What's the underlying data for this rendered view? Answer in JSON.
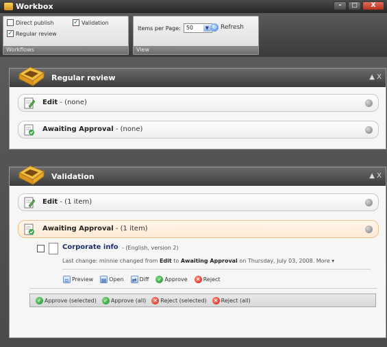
{
  "window": {
    "title": "Workbox",
    "controls": [
      "-",
      "□",
      "X"
    ]
  },
  "ribbon": {
    "workflows": {
      "label": "Workflows",
      "checkboxes": [
        {
          "label": "Direct publish",
          "checked": false
        },
        {
          "label": "Validation",
          "checked": true
        },
        {
          "label": "Regular review",
          "checked": true
        }
      ]
    },
    "view": {
      "label": "View",
      "items_per_page_label": "Items per Page:",
      "items_per_page_value": "50",
      "refresh_label": "Refresh"
    }
  },
  "panels": [
    {
      "title": "Regular review",
      "controls": "▲ X",
      "rows": [
        {
          "state": "Edit",
          "count": "- (none)"
        },
        {
          "state": "Awaiting Approval",
          "count": "- (none)"
        }
      ]
    },
    {
      "title": "Validation",
      "controls": "▲ X",
      "rows": [
        {
          "state": "Edit",
          "count": "- (1 item)"
        },
        {
          "state": "Awaiting Approval",
          "count": "- (1 item)"
        }
      ],
      "item": {
        "title": "Corporate info",
        "meta": "- (English, version 2)",
        "last_change_prefix": "Last change:",
        "last_change_text_1": "minnie changed from",
        "from_state": "Edit",
        "to_word": "to",
        "to_state": "Awaiting Approval",
        "date_text": "on Thursday, July 03, 2008.",
        "more_label": "More ▾"
      },
      "item_actions": [
        "Preview",
        "Open",
        "Diff",
        "Approve",
        "Reject"
      ],
      "bulk_actions": [
        "Approve (selected)",
        "Approve (all)",
        "Reject (selected)",
        "Reject (all)"
      ]
    }
  ]
}
